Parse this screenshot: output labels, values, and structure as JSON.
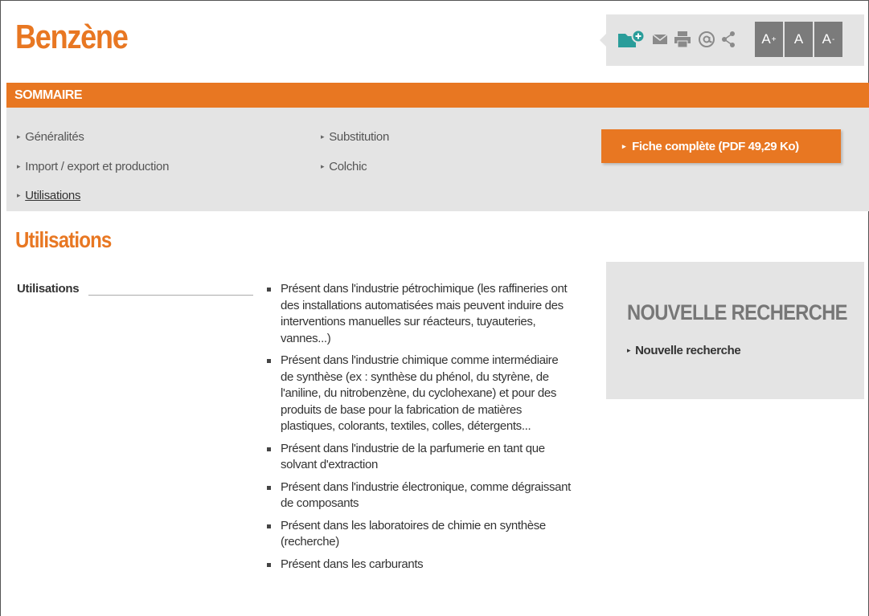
{
  "header": {
    "title": "Benzène"
  },
  "toolbar": {
    "icons": [
      "folder-add-icon",
      "mail-icon",
      "print-icon",
      "at-icon",
      "share-icon"
    ],
    "font_increase": "A",
    "font_increase_sup": "+",
    "font_reset": "A",
    "font_decrease": "A",
    "font_decrease_sup": "-"
  },
  "sommaire": {
    "label": "SOMMAIRE",
    "links": {
      "generalites": "Généralités",
      "import_export": "Import / export et production",
      "utilisations": "Utilisations",
      "substitution": "Substitution",
      "colchic": "Colchic"
    },
    "bullet": "▸",
    "fiche_button": "Fiche complète (PDF 49,29 Ko)"
  },
  "main": {
    "section_title": "Utilisations",
    "field_label": "Utilisations",
    "items": [
      "Présent dans l'industrie pétrochimique (les raffineries ont des installations automatisées mais peuvent induire des interventions manuelles sur réacteurs, tuyauteries, vannes...)",
      "Présent dans l'industrie chimique comme intermédiaire de synthèse (ex : synthèse du phénol, du styrène, de l'aniline, du nitrobenzène, du cyclohexane) et pour des produits de base pour la fabrication de matières plastiques, colorants, textiles, colles, détergents...",
      "Présent dans l'industrie de la parfumerie en tant que solvant d'extraction",
      "Présent dans l'industrie électronique, comme dégraissant de composants",
      "Présent dans les laboratoires de chimie en synthèse (recherche)",
      "Présent dans les carburants"
    ]
  },
  "sidebar": {
    "title": "NOUVELLE RECHERCHE",
    "link": "Nouvelle recherche"
  },
  "colors": {
    "accent": "#e87722",
    "panel": "#e4e4e4",
    "font_button": "#7b7b7b",
    "icon_teal": "#2a9d9a"
  }
}
